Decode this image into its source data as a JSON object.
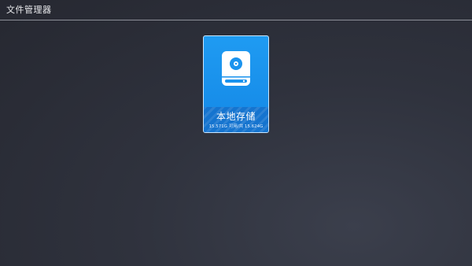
{
  "window": {
    "title": "文件管理器"
  },
  "storage": {
    "name": "本地存储",
    "available": "15.571G",
    "available_label": "可用",
    "total_label": "共",
    "total": "15.624G",
    "capacity_text": "15.571G 可用/共 15.624G",
    "icon": "hard-drive-icon"
  },
  "colors": {
    "background": "#2f323d",
    "card": "#1a93ee",
    "card_footer": "#1574cf",
    "card_border": "#c9e6ff"
  }
}
